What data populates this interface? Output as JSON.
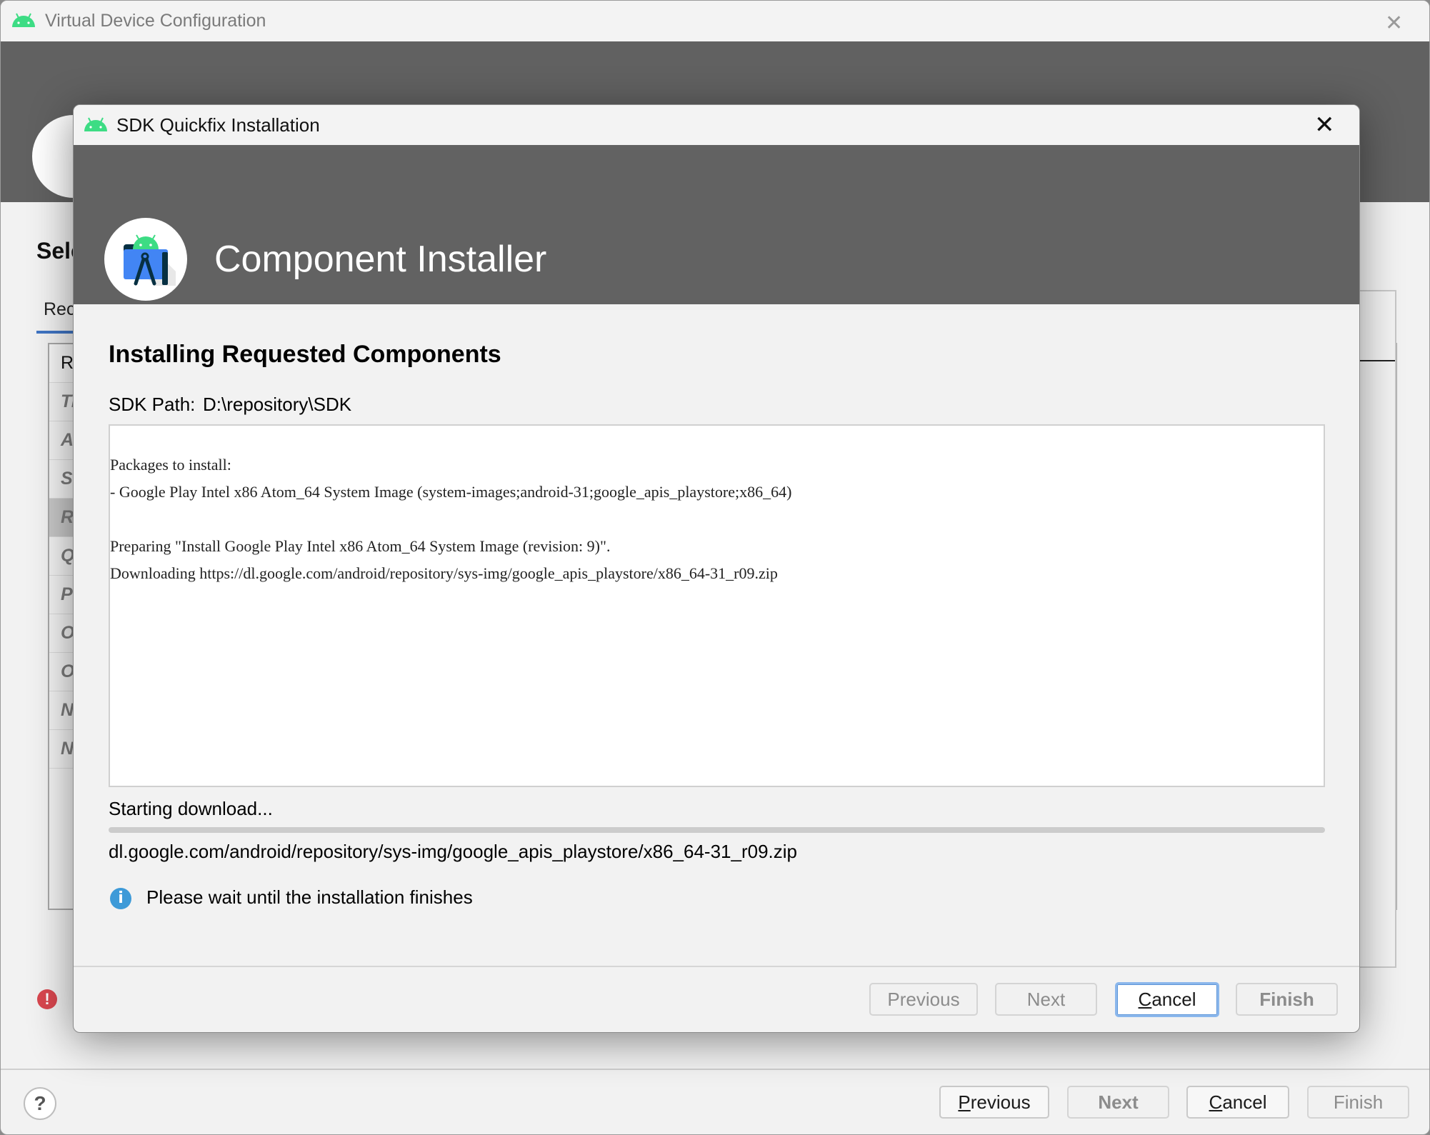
{
  "background_window": {
    "title": "Virtual Device Configuration",
    "close_glyph": "✕",
    "heading_partial": "Sele",
    "tab_partial": "Rec",
    "table_header_partial": "R",
    "table_rows_partial": [
      "Ti",
      "Al",
      "S",
      "R",
      "Q",
      "Pi",
      "O",
      "O",
      "N",
      "N"
    ],
    "selected_row_index": 3,
    "error_glyph": "!",
    "help_glyph": "?",
    "footer_buttons": {
      "previous": {
        "mnemonic": "P",
        "rest": "revious"
      },
      "next": "Next",
      "cancel": {
        "mnemonic": "C",
        "rest": "ancel"
      },
      "finish": "Finish"
    }
  },
  "dialog": {
    "title": "SDK Quickfix Installation",
    "close_glyph": "✕",
    "header_title": "Component Installer",
    "heading": "Installing Requested Components",
    "sdk_path_label": "SDK Path:",
    "sdk_path_value": "D:\\repository\\SDK",
    "log_lines": [
      "Packages to install:",
      "- Google Play Intel x86 Atom_64 System Image (system-images;android-31;google_apis_playstore;x86_64)",
      "",
      "Preparing \"Install Google Play Intel x86 Atom_64 System Image (revision: 9)\".",
      "Downloading https://dl.google.com/android/repository/sys-img/google_apis_playstore/x86_64-31_r09.zip"
    ],
    "status": "Starting download...",
    "progress_percent": 0,
    "download_url": "dl.google.com/android/repository/sys-img/google_apis_playstore/x86_64-31_r09.zip",
    "info_glyph": "i",
    "info_message": "Please wait until the installation finishes",
    "buttons": {
      "previous": "Previous",
      "next": "Next",
      "cancel": {
        "mnemonic": "C",
        "rest": "ancel"
      },
      "finish": "Finish"
    }
  },
  "colors": {
    "header_bg": "#626262",
    "android_green": "#3ddc84",
    "studio_blue": "#4285f4",
    "focus_ring": "#8bb7ec",
    "info_blue": "#3d9ad8",
    "error_red": "#d9474f"
  }
}
